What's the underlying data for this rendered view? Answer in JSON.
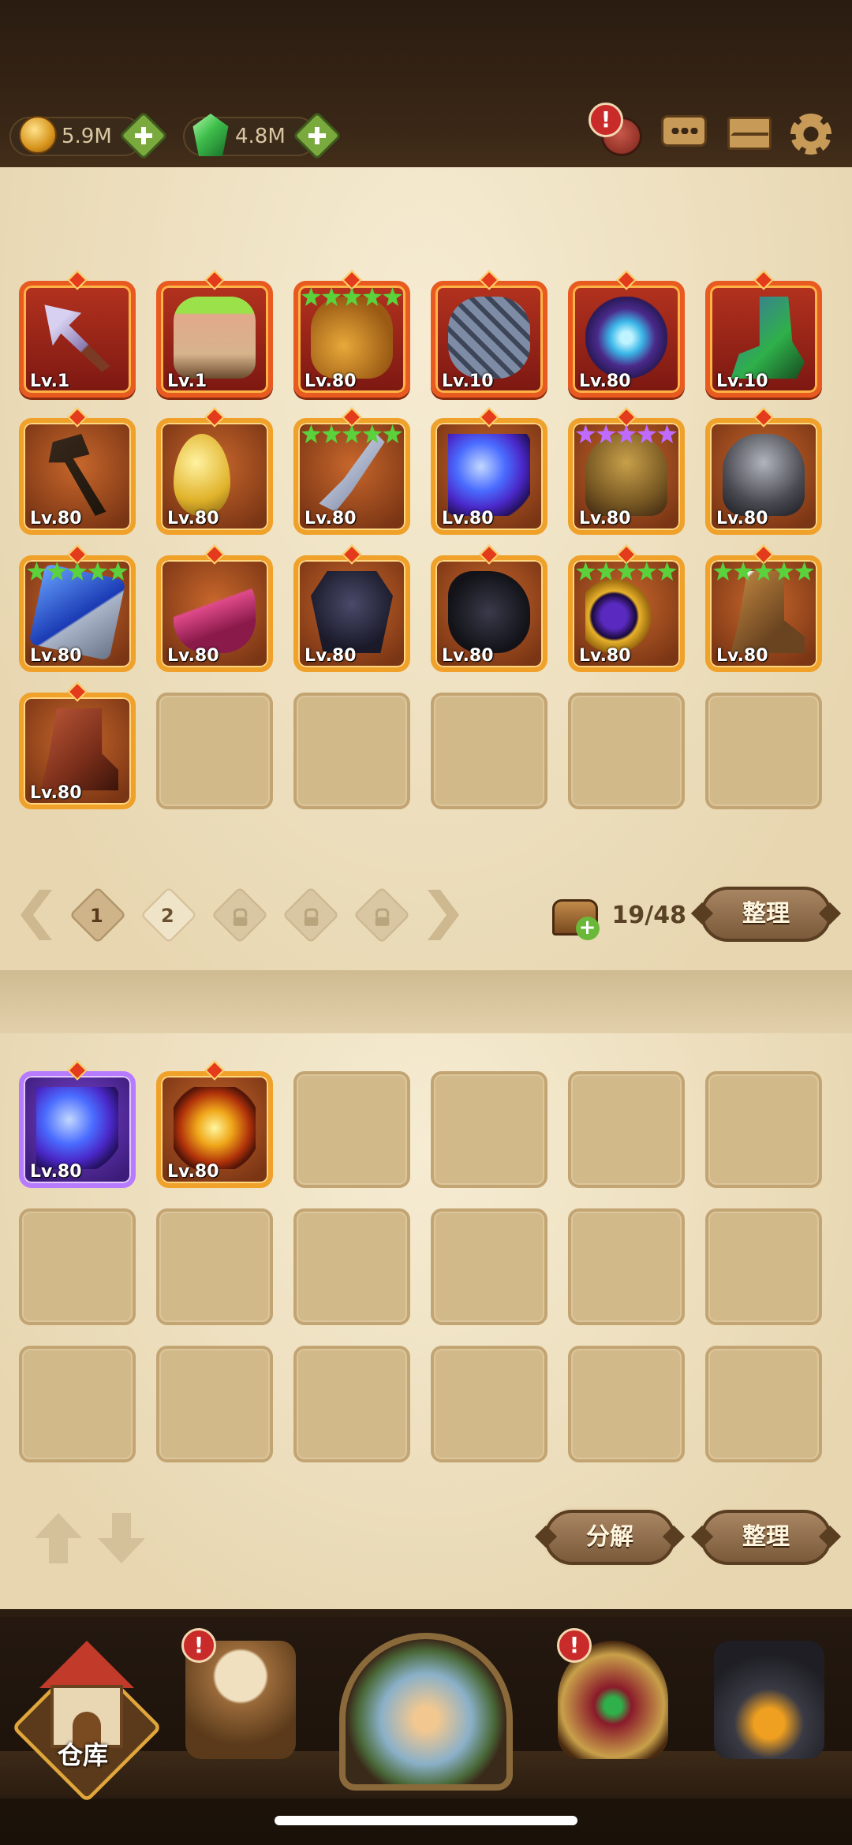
{
  "currencies": {
    "gold": {
      "value": "5.9M",
      "icon": "coin-icon"
    },
    "gems": {
      "value": "4.8M",
      "icon": "gem-icon"
    }
  },
  "alerts": {
    "mark": "!"
  },
  "inventory": {
    "items": [
      {
        "level": "Lv.1",
        "rarity": "red",
        "art": "a-arrow",
        "icon": "arrow-icon"
      },
      {
        "level": "Lv.1",
        "rarity": "red",
        "art": "a-drum",
        "icon": "drum-icon"
      },
      {
        "level": "Lv.80",
        "rarity": "red",
        "art": "a-gaunt",
        "icon": "gauntlet-icon",
        "stars": 5,
        "star_color": "green"
      },
      {
        "level": "Lv.10",
        "rarity": "red",
        "art": "a-chain",
        "icon": "chain-glove-icon"
      },
      {
        "level": "Lv.80",
        "rarity": "red",
        "art": "a-amul",
        "icon": "amulet-icon"
      },
      {
        "level": "Lv.10",
        "rarity": "red",
        "art": "a-boot",
        "icon": "boots-icon"
      },
      {
        "level": "Lv.80",
        "rarity": "orange",
        "art": "a-staff",
        "icon": "staff-icon"
      },
      {
        "level": "Lv.80",
        "rarity": "orange",
        "art": "a-egg",
        "icon": "seed-icon"
      },
      {
        "level": "Lv.80",
        "rarity": "orange",
        "art": "a-sword",
        "icon": "sword-icon",
        "stars": 5,
        "star_color": "green"
      },
      {
        "level": "Lv.80",
        "rarity": "orange",
        "art": "a-orb",
        "icon": "orb-icon"
      },
      {
        "level": "Lv.80",
        "rarity": "orange",
        "art": "a-helm",
        "icon": "helmet-icon",
        "stars": 5,
        "star_color": "purple"
      },
      {
        "level": "Lv.80",
        "rarity": "orange",
        "art": "a-helm2",
        "icon": "iron-helmet-icon"
      },
      {
        "level": "Lv.80",
        "rarity": "orange",
        "art": "a-sq",
        "icon": "blue-gem-icon",
        "stars": 5,
        "star_color": "green"
      },
      {
        "level": "Lv.80",
        "rarity": "orange",
        "art": "a-neck",
        "icon": "necklace-icon"
      },
      {
        "level": "Lv.80",
        "rarity": "orange",
        "art": "a-armor",
        "icon": "armor-icon"
      },
      {
        "level": "Lv.80",
        "rarity": "orange",
        "art": "a-glove",
        "icon": "glove-icon"
      },
      {
        "level": "Lv.80",
        "rarity": "orange",
        "art": "a-ring",
        "icon": "ring-icon",
        "stars": 5,
        "star_color": "green"
      },
      {
        "level": "Lv.80",
        "rarity": "orange",
        "art": "a-boot2",
        "icon": "fur-boots-icon",
        "stars": 5,
        "star_color": "green"
      },
      {
        "level": "Lv.80",
        "rarity": "orange",
        "art": "a-boot3",
        "icon": "leather-boots-icon"
      }
    ],
    "slot_count": 24,
    "pages": [
      {
        "label": "1",
        "state": "active"
      },
      {
        "label": "2",
        "state": "normal"
      },
      {
        "label": "",
        "state": "locked"
      },
      {
        "label": "",
        "state": "locked"
      },
      {
        "label": "",
        "state": "locked"
      }
    ],
    "capacity": "19/48",
    "sort_label": "整理"
  },
  "salvage": {
    "items": [
      {
        "level": "Lv.80",
        "rarity": "purple",
        "art": "a-orb",
        "icon": "orb-icon"
      },
      {
        "level": "Lv.80",
        "rarity": "orange",
        "art": "a-sun",
        "icon": "sun-orb-icon"
      }
    ],
    "slot_count": 18,
    "decompose_label": "分解",
    "sort_label": "整理"
  },
  "nav": {
    "home_label": "仓库",
    "items": [
      "home",
      "tavern",
      "portal",
      "altar",
      "forge"
    ]
  },
  "colors": {
    "parchment": "#efe2c2",
    "accent": "#e0a63a",
    "alert": "#c92a2a"
  }
}
